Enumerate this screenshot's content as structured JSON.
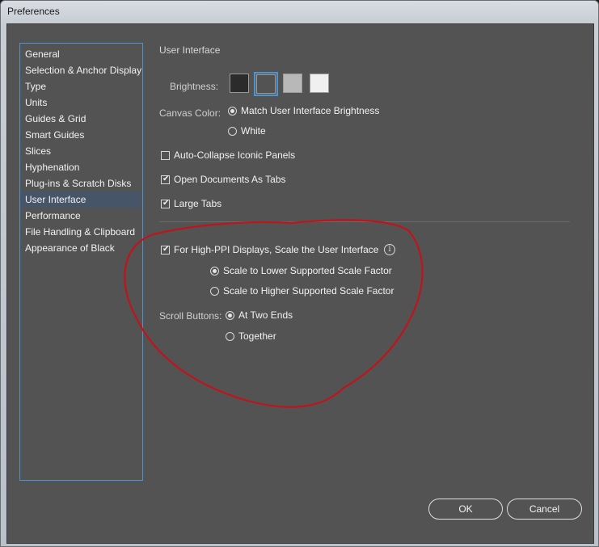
{
  "window": {
    "title": "Preferences"
  },
  "sidebar": {
    "items": [
      {
        "label": "General"
      },
      {
        "label": "Selection & Anchor Display"
      },
      {
        "label": "Type"
      },
      {
        "label": "Units"
      },
      {
        "label": "Guides & Grid"
      },
      {
        "label": "Smart Guides"
      },
      {
        "label": "Slices"
      },
      {
        "label": "Hyphenation"
      },
      {
        "label": "Plug-ins & Scratch Disks"
      },
      {
        "label": "User Interface",
        "selected": true
      },
      {
        "label": "Performance"
      },
      {
        "label": "File Handling & Clipboard"
      },
      {
        "label": "Appearance of Black"
      }
    ]
  },
  "panel": {
    "title": "User Interface",
    "brightness": {
      "label": "Brightness:",
      "swatches": [
        "#2b2b2b",
        "#535353",
        "#b8b8b8",
        "#f0f0f0"
      ],
      "selected_index": 1
    },
    "canvas_color": {
      "label": "Canvas Color:",
      "options": [
        "Match User Interface Brightness",
        "White"
      ],
      "selected": "Match User Interface Brightness"
    },
    "auto_collapse": {
      "label": "Auto-Collapse Iconic Panels",
      "checked": false
    },
    "open_as_tabs": {
      "label": "Open Documents As Tabs",
      "checked": true
    },
    "large_tabs": {
      "label": "Large Tabs",
      "checked": true
    },
    "high_ppi": {
      "label": "For High-PPI Displays, Scale the User Interface",
      "checked": true,
      "info_icon": "info-icon",
      "options": [
        "Scale to Lower Supported Scale Factor",
        "Scale to Higher Supported Scale Factor"
      ],
      "selected": "Scale to Lower Supported Scale Factor"
    },
    "scroll_buttons": {
      "label": "Scroll Buttons:",
      "options": [
        "At Two Ends",
        "Together"
      ],
      "selected": "At Two Ends"
    }
  },
  "buttons": {
    "ok": "OK",
    "cancel": "Cancel"
  },
  "annotation": {
    "color": "#c0141c"
  }
}
